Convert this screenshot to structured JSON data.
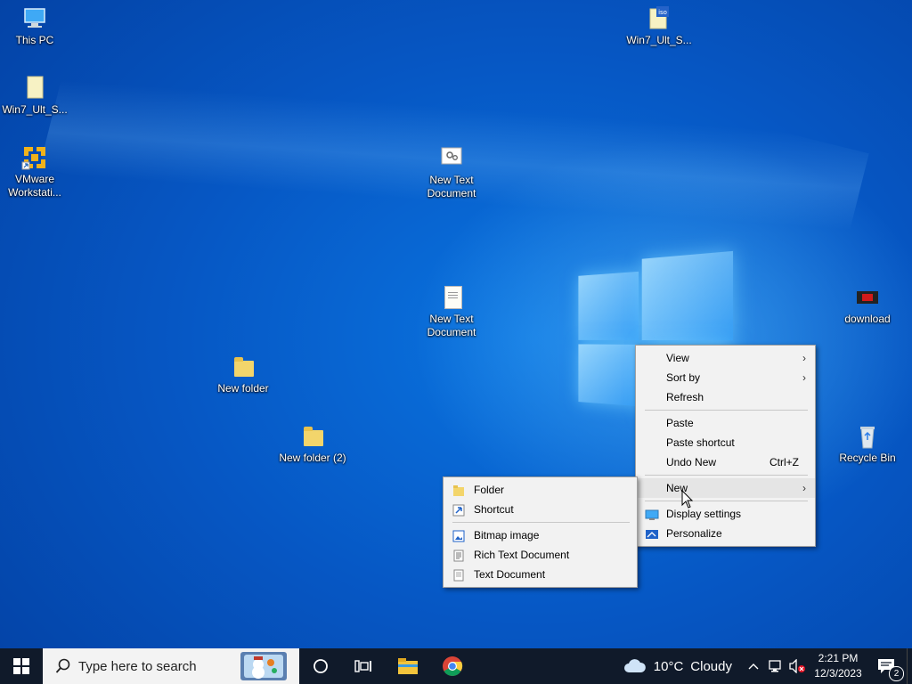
{
  "desktop": {
    "icons": [
      {
        "label": "This PC"
      },
      {
        "label": "Win7_Ult_S..."
      },
      {
        "label": "VMware Workstati..."
      },
      {
        "label": "Win7_Ult_S..."
      },
      {
        "label": "New Text Document"
      },
      {
        "label": "New Text Document"
      },
      {
        "label": "download"
      },
      {
        "label": "New folder"
      },
      {
        "label": "New folder (2)"
      },
      {
        "label": "Recycle Bin"
      }
    ]
  },
  "context_menu": {
    "view": "View",
    "sort_by": "Sort by",
    "refresh": "Refresh",
    "paste": "Paste",
    "paste_shortcut": "Paste shortcut",
    "undo_new": "Undo New",
    "undo_shortcut": "Ctrl+Z",
    "new": "New",
    "display_settings": "Display settings",
    "personalize": "Personalize"
  },
  "new_submenu": {
    "folder": "Folder",
    "shortcut": "Shortcut",
    "bitmap": "Bitmap image",
    "rich_text": "Rich Text Document",
    "text_doc": "Text Document"
  },
  "taskbar": {
    "search_placeholder": "Type here to search",
    "weather_temp": "10°C",
    "weather_desc": "Cloudy",
    "time": "2:21 PM",
    "date": "12/3/2023",
    "notification_count": "2"
  },
  "colors": {
    "desktop_accent": "#0657c4",
    "taskbar": "#101a2a",
    "menu_bg": "#f2f2f2",
    "menu_hover": "#e5e5e5"
  }
}
